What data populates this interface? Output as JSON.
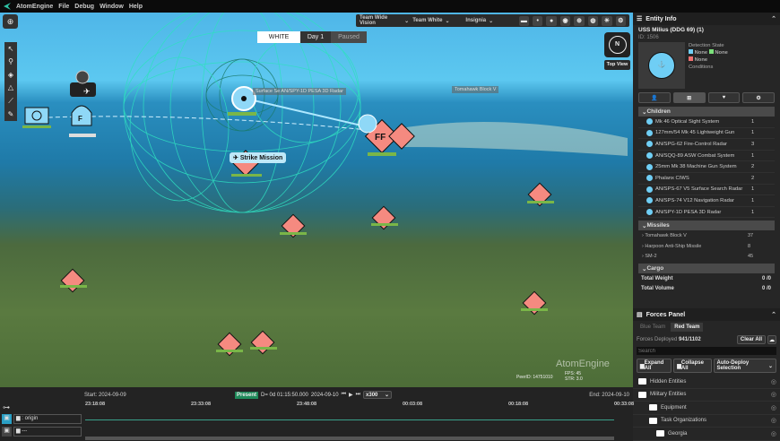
{
  "menubar": {
    "app": "AtomEngine",
    "items": [
      "File",
      "Debug",
      "Window",
      "Help"
    ]
  },
  "map": {
    "toolbar": {
      "vision": "Team Wide Vision",
      "team": "Team White",
      "display": "Insignia"
    },
    "time": {
      "team": "WHITE",
      "day": "Day 1",
      "state": "Paused"
    },
    "compass": "N",
    "top_view": "Top View",
    "labels": {
      "sensor": "Surface Se AN/SPY-1D PESA 3D Radar",
      "missile": "Tomahawk Block V",
      "strike": "Strike Mission",
      "unit_ff": "FF",
      "unit_f": "F"
    },
    "watermark": "AtomEngine",
    "peer": "PeerID: 14751010",
    "stats": [
      "FPS: 45",
      "STR: 3.0"
    ]
  },
  "entity_info": {
    "title": "Entity Info",
    "name": "USS Milius (DDG 69)  (1)",
    "id": "ID: 1506",
    "detection_label": "Detection State",
    "detection": [
      {
        "value": "None",
        "color": "#6fcef5"
      },
      {
        "value": "None",
        "color": "#7be07b"
      },
      {
        "value": "None",
        "color": "#f07070"
      }
    ],
    "conditions": "Conditions",
    "children_label": "Children",
    "children": [
      {
        "name": "Mk 46 Optical Sight System",
        "count": "1"
      },
      {
        "name": "127mm/54 Mk 45 Lightweight Gun",
        "count": "1"
      },
      {
        "name": "AN/SPG-62 Fire-Control Radar",
        "count": "3"
      },
      {
        "name": "AN/SQQ-89 ASW Combat System",
        "count": "1"
      },
      {
        "name": "25mm Mk 38 Machine Gun System",
        "count": "2"
      },
      {
        "name": "Phalanx CIWS",
        "count": "2"
      },
      {
        "name": "AN/SPS-67 V5 Surface Search Radar",
        "count": "1"
      },
      {
        "name": "AN/SPS-74 V12 Navigation Radar",
        "count": "1"
      },
      {
        "name": "AN/SPY-1D PESA 3D Radar",
        "count": "1"
      }
    ],
    "missiles_label": "Missiles",
    "missiles": [
      {
        "name": "Tomahawk Block V",
        "count": "37"
      },
      {
        "name": "Harpoon Anti-Ship Missile",
        "count": "8"
      },
      {
        "name": "SM-2",
        "count": "45"
      }
    ],
    "cargo_label": "Cargo",
    "cargo": [
      {
        "name": "Total Weight",
        "value": "0 /0"
      },
      {
        "name": "Total Volume",
        "value": "0 /0"
      }
    ]
  },
  "forces": {
    "title": "Forces Panel",
    "tabs": [
      "Blue Team",
      "Red Team"
    ],
    "deployed_label": "Forces Deployed",
    "deployed": "941/1102",
    "clear_all": "Clear All",
    "search_placeholder": "Search",
    "expand_all": "Expand All",
    "collapse_all": "Collapse All",
    "auto_deploy": "Auto-Deploy Selection",
    "tree": [
      "Hidden Entities",
      "Military Entities",
      "Equipment",
      "Task Organizations",
      "Georgia"
    ]
  },
  "timeline": {
    "start": "Start: 2024-09-09",
    "end": "End: 2024-09-10",
    "present": "Present",
    "delta": "D= 0d 01:15:50.000",
    "date": "2024-09-10",
    "speed": "x300",
    "ticks": [
      "23:18:08",
      "23:33:08",
      "23:48:08",
      "00:03:08",
      "00:18:08",
      "00:33:08"
    ],
    "tracks": [
      "origin",
      "---"
    ]
  }
}
